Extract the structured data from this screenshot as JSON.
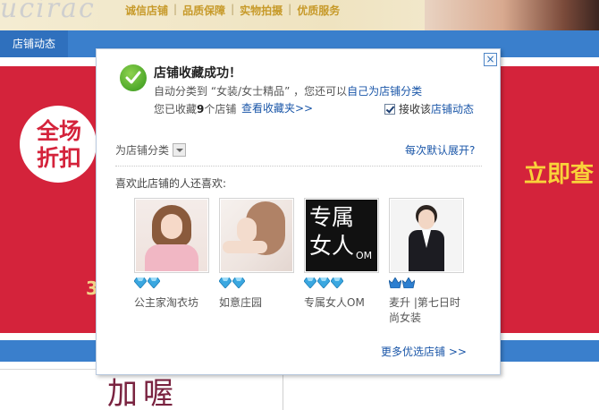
{
  "background": {
    "banner_script": "ucirac",
    "service_links": [
      "诚信店铺",
      "品质保障",
      "实物拍摄",
      "优质服务"
    ],
    "service_separator": "|",
    "nav_tab": "店铺动态",
    "promo_circle_text": "全场折扣",
    "promo_right_text": "立即查",
    "promo_fragment": "3",
    "bottom_text": "加喔"
  },
  "dialog": {
    "close_label": "×",
    "title": "店铺收藏成功！",
    "auto_prefix": "自动分类到 “女装/女士精品” ，您还可以",
    "auto_link": "自己为店铺分类",
    "count_prefix": "您已收藏",
    "count_value": "9",
    "count_suffix": "个店铺",
    "view_favorites": "查看收藏夹>>",
    "subscribe_label": "接收该",
    "subscribe_link": "店铺动态",
    "subscribe_checked": true,
    "classify_label": "为店铺分类",
    "expand_default": "每次默认展开?",
    "also_like": "喜欢此店铺的人还喜欢:",
    "shops": [
      {
        "name": "公主家淘衣坊",
        "rank_icon": "blue-diamond",
        "rank_count": 2
      },
      {
        "name": "如意庄园",
        "rank_icon": "blue-diamond",
        "rank_count": 2
      },
      {
        "name": "专属女人OM",
        "rank_icon": "blue-diamond",
        "rank_count": 3,
        "image_text": [
          "专属",
          "女人",
          "OM"
        ]
      },
      {
        "name": "麦升 |第七日时尚女装",
        "rank_icon": "blue-crown",
        "rank_count": 2
      }
    ],
    "more_shops": "更多优选店铺 >>"
  },
  "colors": {
    "link_blue": "#1a56a8",
    "nav_blue": "#3a7fcc",
    "promo_red": "#d4233b",
    "success_green": "#4ea82a",
    "diamond_blue": "#3aa7e0",
    "crown_blue": "#2d7fd0"
  }
}
